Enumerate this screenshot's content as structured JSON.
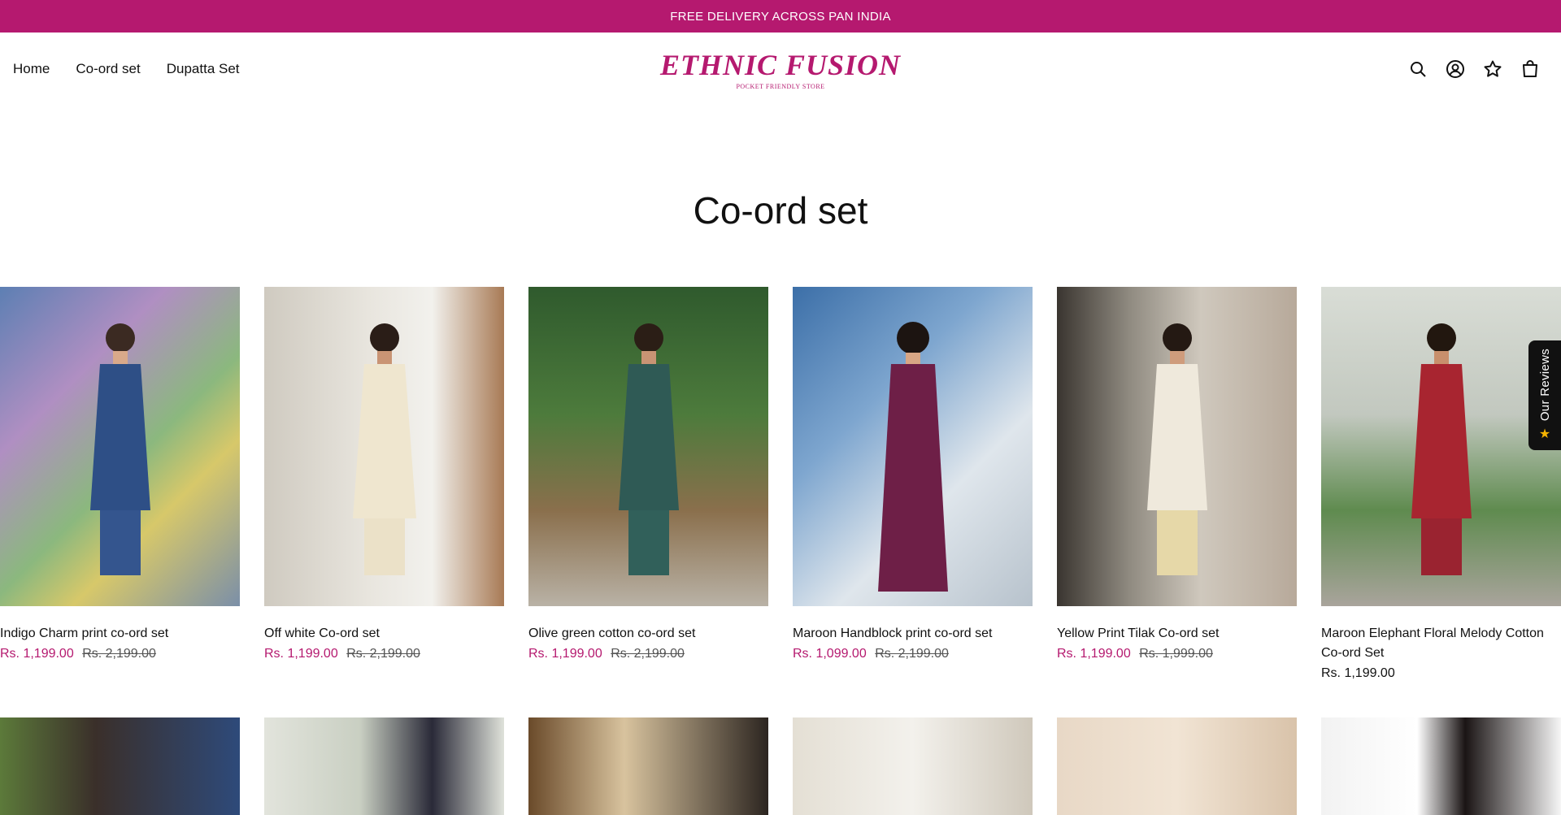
{
  "announcement": "FREE DELIVERY ACROSS PAN INDIA",
  "nav": [
    "Home",
    "Co-ord set",
    "Dupatta Set"
  ],
  "logo": {
    "name": "ETHNIC FUSION",
    "tagline": "POCKET FRIENDLY STORE",
    "color": "#b5196f"
  },
  "header_icons": [
    "search-icon",
    "account-icon",
    "wishlist-star-icon",
    "cart-bag-icon"
  ],
  "page_title": "Co-ord set",
  "colors": {
    "accent": "#b5196f",
    "text": "#111111"
  },
  "products": [
    {
      "title": "Indigo Charm print co-ord set",
      "sale_price": "Rs. 1,199.00",
      "compare_price": "Rs. 2,199.00"
    },
    {
      "title": "Off white Co-ord set",
      "sale_price": "Rs. 1,199.00",
      "compare_price": "Rs. 2,199.00"
    },
    {
      "title": "Olive green cotton co-ord set",
      "sale_price": "Rs. 1,199.00",
      "compare_price": "Rs. 2,199.00"
    },
    {
      "title": "Maroon Handblock print co-ord set",
      "sale_price": "Rs. 1,099.00",
      "compare_price": "Rs. 2,199.00"
    },
    {
      "title": "Yellow Print Tilak Co-ord set",
      "sale_price": "Rs. 1,199.00",
      "compare_price": "Rs. 1,999.00"
    },
    {
      "title": "Maroon Elephant Floral Melody Cotton Co-ord Set",
      "regular_price": "Rs. 1,199.00"
    }
  ],
  "reviews_tab": "Our Reviews"
}
